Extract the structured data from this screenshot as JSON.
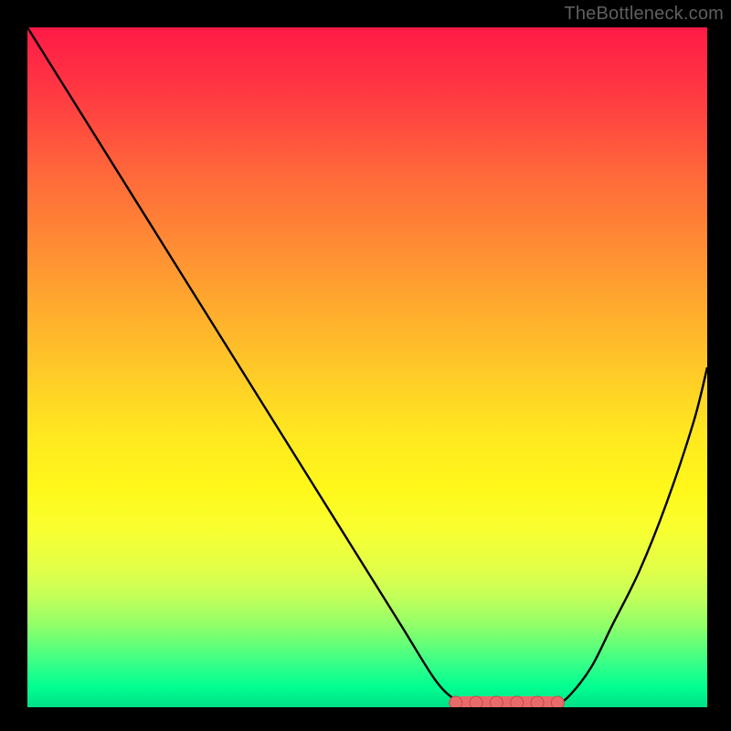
{
  "watermark": "TheBottleneck.com",
  "chart_data": {
    "type": "line",
    "title": "",
    "xlabel": "",
    "ylabel": "",
    "xlim": [
      0,
      100
    ],
    "ylim": [
      0,
      100
    ],
    "x": [
      0,
      5,
      10,
      15,
      20,
      25,
      30,
      35,
      40,
      45,
      50,
      55,
      60,
      63,
      65,
      68,
      70,
      72,
      75,
      78,
      80,
      83,
      86,
      90,
      94,
      98,
      100
    ],
    "y": [
      100,
      92,
      84,
      76,
      68,
      60,
      52,
      44,
      36,
      28,
      20,
      12,
      4,
      1,
      0,
      0,
      0,
      0,
      0,
      0.5,
      2,
      6,
      12,
      20,
      30,
      42,
      50
    ],
    "trough_markers": {
      "x": [
        63,
        66,
        69,
        72,
        75,
        78
      ],
      "y": [
        0,
        0,
        0,
        0,
        0,
        0
      ]
    },
    "notes": "Values are read in percent of the plotting area. The curve descends from top-left, reaches a minimum plateau around x≈63–78, then rises toward the right edge. Red markers sit along the bottom of the trough."
  }
}
